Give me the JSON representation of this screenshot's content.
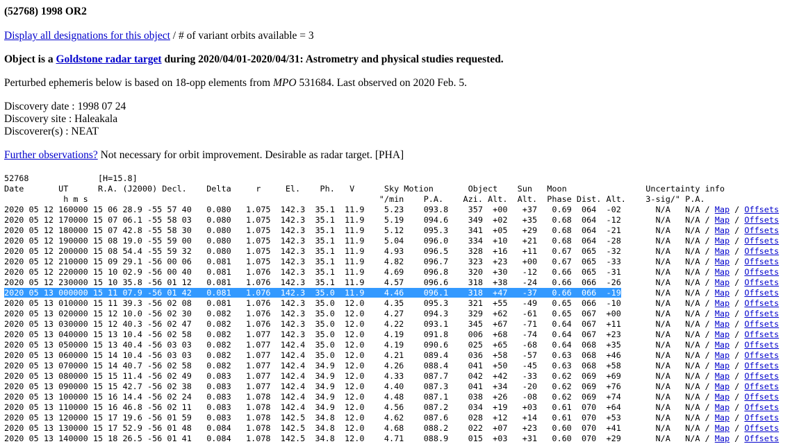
{
  "object": {
    "title": "(52768) 1998 OR2"
  },
  "designations": {
    "link_text": "Display all designations for this object",
    "sep": " / ",
    "variant_text": "# of variant orbits available = 3"
  },
  "radar": {
    "prefix": "Object is a ",
    "link_text": "Goldstone radar target",
    "suffix": " during 2020/04/01-2020/04/31: Astrometry and physical studies requested."
  },
  "perturbed": {
    "before": "Perturbed ephemeris below is based on 18-opp elements from ",
    "mpo": "MPO",
    "after": " 531684. Last observed on 2020 Feb. 5."
  },
  "discovery": {
    "date": "Discovery date : 1998 07 24",
    "site": "Discovery site : Haleakala",
    "discoverer": "Discoverer(s) : NEAT"
  },
  "further": {
    "link_text": "Further observations?",
    "text": " Not necessary for orbit improvement. Desirable as radar target. [PHA]"
  },
  "ephemeris": {
    "header_lines": [
      "52768              [H=15.8]",
      "Date       UT      R.A. (J2000) Decl.    Delta     r     El.    Ph.   V      Sky Motion       Object    Sun   Moon                Uncertainty info",
      "            h m s                                                           \"/min    P.A.    Azi. Alt.  Alt.  Phase Dist. Alt.    3-sig/\" P.A."
    ],
    "link_sep": " / ",
    "map_label": "Map",
    "offsets_label": "Offsets",
    "selected_index": 8,
    "rows": [
      {
        "data": "2020 05 12 160000 15 06 28.9 -55 57 40   0.080   1.075  142.3  35.1  11.9    5.23    093.8    357  +00   +37   0.69  064  -02",
        "unc": "       N/A   N/A"
      },
      {
        "data": "2020 05 12 170000 15 07 06.1 -55 58 03   0.080   1.075  142.3  35.1  11.9    5.19    094.6    349  +02   +35   0.68  064  -12",
        "unc": "       N/A   N/A"
      },
      {
        "data": "2020 05 12 180000 15 07 42.8 -55 58 30   0.080   1.075  142.3  35.1  11.9    5.12    095.3    341  +05   +29   0.68  064  -21",
        "unc": "       N/A   N/A"
      },
      {
        "data": "2020 05 12 190000 15 08 19.0 -55 59 00   0.080   1.075  142.3  35.1  11.9    5.04    096.0    334  +10   +21   0.68  064  -28",
        "unc": "       N/A   N/A"
      },
      {
        "data": "2020 05 12 200000 15 08 54.4 -55 59 32   0.080   1.075  142.3  35.1  11.9    4.93    096.5    328  +16   +11   0.67  065  -32",
        "unc": "       N/A   N/A"
      },
      {
        "data": "2020 05 12 210000 15 09 29.1 -56 00 06   0.081   1.075  142.3  35.1  11.9    4.82    096.7    323  +23   +00   0.67  065  -33",
        "unc": "       N/A   N/A"
      },
      {
        "data": "2020 05 12 220000 15 10 02.9 -56 00 40   0.081   1.076  142.3  35.1  11.9    4.69    096.8    320  +30   -12   0.66  065  -31",
        "unc": "       N/A   N/A"
      },
      {
        "data": "2020 05 12 230000 15 10 35.8 -56 01 12   0.081   1.076  142.3  35.1  11.9    4.57    096.6    318  +38   -24   0.66  066  -26",
        "unc": "       N/A   N/A"
      },
      {
        "data": "2020 05 13 000000 15 11 07.9 -56 01 42   0.081   1.076  142.3  35.0  11.9    4.46    096.1    318  +47   -37   0.66  066  -19",
        "unc": "       N/A   N/A"
      },
      {
        "data": "2020 05 13 010000 15 11 39.3 -56 02 08   0.081   1.076  142.3  35.0  12.0    4.35    095.3    321  +55   -49   0.65  066  -10",
        "unc": "       N/A   N/A"
      },
      {
        "data": "2020 05 13 020000 15 12 10.0 -56 02 30   0.082   1.076  142.3  35.0  12.0    4.27    094.3    329  +62   -61   0.65  067  +00",
        "unc": "       N/A   N/A"
      },
      {
        "data": "2020 05 13 030000 15 12 40.3 -56 02 47   0.082   1.076  142.3  35.0  12.0    4.22    093.1    345  +67   -71   0.64  067  +11",
        "unc": "       N/A   N/A"
      },
      {
        "data": "2020 05 13 040000 15 13 10.4 -56 02 58   0.082   1.077  142.3  35.0  12.0    4.19    091.8    006  +68   -74   0.64  067  +23",
        "unc": "       N/A   N/A"
      },
      {
        "data": "2020 05 13 050000 15 13 40.4 -56 03 03   0.082   1.077  142.4  35.0  12.0    4.19    090.6    025  +65   -68   0.64  068  +35",
        "unc": "       N/A   N/A"
      },
      {
        "data": "2020 05 13 060000 15 14 10.4 -56 03 03   0.082   1.077  142.4  35.0  12.0    4.21    089.4    036  +58   -57   0.63  068  +46",
        "unc": "       N/A   N/A"
      },
      {
        "data": "2020 05 13 070000 15 14 40.7 -56 02 58   0.082   1.077  142.4  34.9  12.0    4.26    088.4    041  +50   -45   0.63  068  +58",
        "unc": "       N/A   N/A"
      },
      {
        "data": "2020 05 13 080000 15 15 11.4 -56 02 49   0.083   1.077  142.4  34.9  12.0    4.33    087.7    042  +42   -33   0.62  069  +69",
        "unc": "       N/A   N/A"
      },
      {
        "data": "2020 05 13 090000 15 15 42.7 -56 02 38   0.083   1.077  142.4  34.9  12.0    4.40    087.3    041  +34   -20   0.62  069  +76",
        "unc": "       N/A   N/A"
      },
      {
        "data": "2020 05 13 100000 15 16 14.4 -56 02 24   0.083   1.078  142.4  34.9  12.0    4.48    087.1    038  +26   -08   0.62  069  +74",
        "unc": "       N/A   N/A"
      },
      {
        "data": "2020 05 13 110000 15 16 46.8 -56 02 11   0.083   1.078  142.4  34.9  12.0    4.56    087.2    034  +19   +03   0.61  070  +64",
        "unc": "       N/A   N/A"
      },
      {
        "data": "2020 05 13 120000 15 17 19.6 -56 01 59   0.083   1.078  142.5  34.8  12.0    4.62    087.6    028  +12   +14   0.61  070  +53",
        "unc": "       N/A   N/A"
      },
      {
        "data": "2020 05 13 130000 15 17 52.9 -56 01 48   0.084   1.078  142.5  34.8  12.0    4.68    088.2    022  +07   +23   0.60  070  +41",
        "unc": "       N/A   N/A"
      },
      {
        "data": "2020 05 13 140000 15 18 26.5 -56 01 41   0.084   1.078  142.5  34.8  12.0    4.71    088.9    015  +03   +31   0.60  070  +29",
        "unc": "       N/A   N/A"
      }
    ]
  }
}
